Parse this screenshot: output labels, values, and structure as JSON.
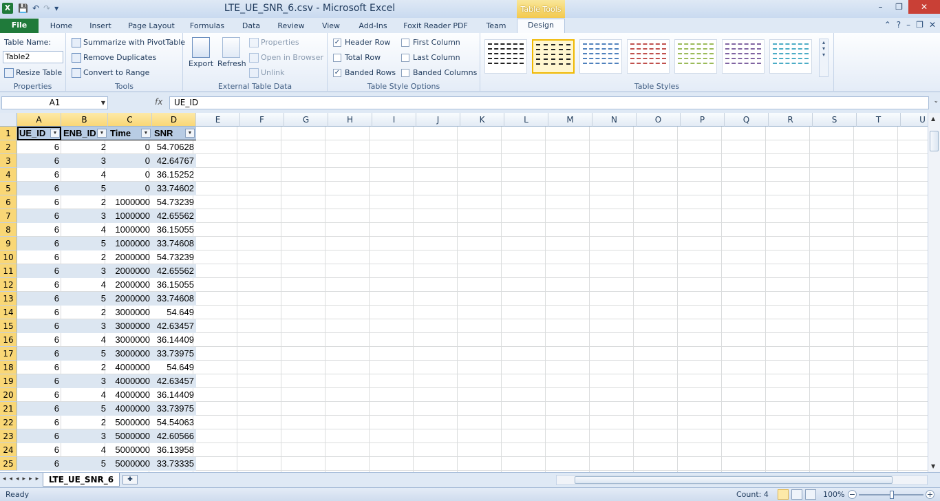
{
  "window": {
    "title": "LTE_UE_SNR_6.csv - Microsoft Excel",
    "context_tab": "Table Tools",
    "app_icon_letter": "X",
    "controls": [
      "–",
      "❐",
      "✕"
    ]
  },
  "ribbon_tabs": [
    "File",
    "Home",
    "Insert",
    "Page Layout",
    "Formulas",
    "Data",
    "Review",
    "View",
    "Add-Ins",
    "Foxit Reader PDF",
    "Team",
    "Design"
  ],
  "properties": {
    "table_name_label": "Table Name:",
    "table_name_value": "Table2",
    "resize_label": "Resize Table",
    "group_label": "Properties"
  },
  "tools": {
    "summarize": "Summarize with PivotTable",
    "remove_dup": "Remove Duplicates",
    "convert": "Convert to Range",
    "group_label": "Tools"
  },
  "external": {
    "export": "Export",
    "refresh": "Refresh",
    "properties": "Properties",
    "open_browser": "Open in Browser",
    "unlink": "Unlink",
    "group_label": "External Table Data"
  },
  "style_options": {
    "header_row": "Header Row",
    "total_row": "Total Row",
    "banded_rows": "Banded Rows",
    "first_column": "First Column",
    "last_column": "Last Column",
    "banded_columns": "Banded Columns",
    "checked": {
      "header_row": true,
      "total_row": false,
      "banded_rows": true,
      "first_column": false,
      "last_column": false,
      "banded_columns": false
    },
    "group_label": "Table Style Options"
  },
  "table_styles": {
    "group_label": "Table Styles",
    "colors": [
      "#222222",
      "#222222",
      "#4f81bd",
      "#c0504d",
      "#9bbb59",
      "#8064a2",
      "#4bacc6"
    ],
    "selected_index": 1
  },
  "formula_bar": {
    "name_box": "A1",
    "fx": "fx",
    "formula": "UE_ID"
  },
  "columns": [
    "A",
    "B",
    "C",
    "D",
    "E",
    "F",
    "G",
    "H",
    "I",
    "J",
    "K",
    "L",
    "M",
    "N",
    "O",
    "P",
    "Q",
    "R",
    "S",
    "T",
    "U"
  ],
  "table": {
    "headers": [
      "UE_ID",
      "ENB_ID",
      "Time",
      "SNR"
    ],
    "rows": [
      [
        "6",
        "2",
        "0",
        "54.70628"
      ],
      [
        "6",
        "3",
        "0",
        "42.64767"
      ],
      [
        "6",
        "4",
        "0",
        "36.15252"
      ],
      [
        "6",
        "5",
        "0",
        "33.74602"
      ],
      [
        "6",
        "2",
        "1000000",
        "54.73239"
      ],
      [
        "6",
        "3",
        "1000000",
        "42.65562"
      ],
      [
        "6",
        "4",
        "1000000",
        "36.15055"
      ],
      [
        "6",
        "5",
        "1000000",
        "33.74608"
      ],
      [
        "6",
        "2",
        "2000000",
        "54.73239"
      ],
      [
        "6",
        "3",
        "2000000",
        "42.65562"
      ],
      [
        "6",
        "4",
        "2000000",
        "36.15055"
      ],
      [
        "6",
        "5",
        "2000000",
        "33.74608"
      ],
      [
        "6",
        "2",
        "3000000",
        "54.649"
      ],
      [
        "6",
        "3",
        "3000000",
        "42.63457"
      ],
      [
        "6",
        "4",
        "3000000",
        "36.14409"
      ],
      [
        "6",
        "5",
        "3000000",
        "33.73975"
      ],
      [
        "6",
        "2",
        "4000000",
        "54.649"
      ],
      [
        "6",
        "3",
        "4000000",
        "42.63457"
      ],
      [
        "6",
        "4",
        "4000000",
        "36.14409"
      ],
      [
        "6",
        "5",
        "4000000",
        "33.73975"
      ],
      [
        "6",
        "2",
        "5000000",
        "54.54063"
      ],
      [
        "6",
        "3",
        "5000000",
        "42.60566"
      ],
      [
        "6",
        "4",
        "5000000",
        "36.13958"
      ],
      [
        "6",
        "5",
        "5000000",
        "33.73335"
      ]
    ]
  },
  "sheet": {
    "tab_name": "LTE_UE_SNR_6",
    "nav": "◂◂◂▸▸▸"
  },
  "status": {
    "ready": "Ready",
    "count": "Count: 4",
    "zoom": "100%"
  }
}
